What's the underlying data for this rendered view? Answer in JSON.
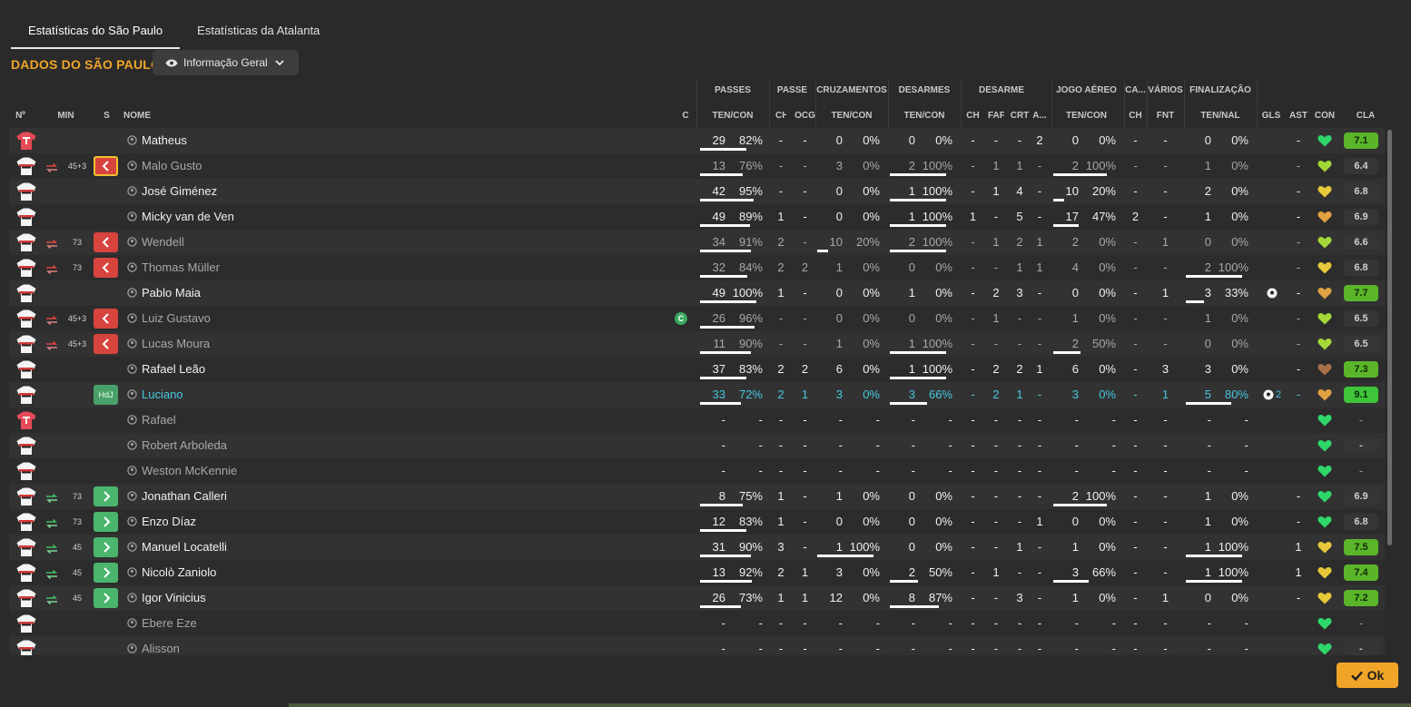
{
  "tabs": [
    {
      "label": "Estatísticas do São Paulo",
      "active": true
    },
    {
      "label": "Estatísticas da Atalanta",
      "active": false
    }
  ],
  "section_title": "DADOS DO SÃO PAULO",
  "view_dropdown": {
    "label": "Informação Geral",
    "icon": "eye-icon"
  },
  "column_groups": [
    "PASSES",
    "PASSE",
    "CRUZAMENTOS",
    "DESARMES",
    "DESARME",
    "JOGO AÉREO",
    "CA...",
    "VÁRIOS",
    "FINALIZAÇÃO"
  ],
  "columns": [
    "Nº",
    "MIN",
    "S",
    "NOME",
    "C",
    "TEN/CON",
    "CH",
    "OCG",
    "TEN/CON",
    "TEN/CON",
    "CH",
    "FAF",
    "CRT",
    "A...",
    "TEN/CON",
    "CH",
    "FNT",
    "TEN/NAL",
    "GLS",
    "AST",
    "CON",
    "CLA"
  ],
  "colors": {
    "accent": "#f0a528",
    "sub_out": "#d7443e",
    "sub_in": "#4bb56e",
    "motm": "#46c8e0",
    "rating_good": "#5ab52a"
  },
  "players": [
    {
      "name": "Matheus",
      "gk": true,
      "sub": "",
      "min": "",
      "pass": [
        "29",
        "82%"
      ],
      "pass_bar": 0.82,
      "ch": "-",
      "ocg": "-",
      "cross": [
        "0",
        "0%"
      ],
      "cross_bar": 0,
      "tackle": [
        "0",
        "0%"
      ],
      "tackle_bar": 0,
      "d_ch": "-",
      "faf": "-",
      "crt": "-",
      "a": "2",
      "air": [
        "0",
        "0%"
      ],
      "air_bar": 0,
      "ca_ch": "-",
      "fnt": "-",
      "shots": [
        "0",
        "0%"
      ],
      "shots_bar": 0,
      "gls": "",
      "ast": "-",
      "con": "green",
      "cla": "7.1",
      "cla_type": "good"
    },
    {
      "name": "Malo Gusto",
      "gk": false,
      "sub": "out",
      "sel": true,
      "min": "45+3",
      "pass": [
        "13",
        "76%"
      ],
      "pass_bar": 0.76,
      "ch": "-",
      "ocg": "-",
      "cross": [
        "3",
        "0%"
      ],
      "cross_bar": 0,
      "tackle": [
        "2",
        "100%"
      ],
      "tackle_bar": 1,
      "d_ch": "-",
      "faf": "1",
      "crt": "1",
      "a": "-",
      "air": [
        "2",
        "100%"
      ],
      "air_bar": 1,
      "ca_ch": "-",
      "fnt": "-",
      "shots": [
        "1",
        "0%"
      ],
      "shots_bar": 0,
      "gls": "",
      "ast": "-",
      "con": "yellowgreen",
      "cla": "6.4",
      "cla_type": "neutral"
    },
    {
      "name": "José Giménez",
      "gk": false,
      "sub": "",
      "min": "",
      "pass": [
        "42",
        "95%"
      ],
      "pass_bar": 0.95,
      "ch": "-",
      "ocg": "-",
      "cross": [
        "0",
        "0%"
      ],
      "cross_bar": 0,
      "tackle": [
        "1",
        "100%"
      ],
      "tackle_bar": 1,
      "d_ch": "-",
      "faf": "1",
      "crt": "4",
      "a": "-",
      "air": [
        "10",
        "20%"
      ],
      "air_bar": 0.2,
      "ca_ch": "-",
      "fnt": "-",
      "shots": [
        "2",
        "0%"
      ],
      "shots_bar": 0,
      "gls": "",
      "ast": "-",
      "con": "yellow",
      "cla": "6.8",
      "cla_type": "neutral"
    },
    {
      "name": "Micky van de Ven",
      "gk": false,
      "sub": "",
      "min": "",
      "pass": [
        "49",
        "89%"
      ],
      "pass_bar": 0.89,
      "ch": "1",
      "ocg": "-",
      "cross": [
        "0",
        "0%"
      ],
      "cross_bar": 0,
      "tackle": [
        "1",
        "100%"
      ],
      "tackle_bar": 1,
      "d_ch": "1",
      "faf": "-",
      "crt": "5",
      "a": "-",
      "air": [
        "17",
        "47%"
      ],
      "air_bar": 0.47,
      "ca_ch": "2",
      "fnt": "-",
      "shots": [
        "1",
        "0%"
      ],
      "shots_bar": 0,
      "gls": "",
      "ast": "-",
      "con": "orange",
      "cla": "6.9",
      "cla_type": "neutral"
    },
    {
      "name": "Wendell",
      "gk": false,
      "sub": "out",
      "min": "73",
      "pass": [
        "34",
        "91%"
      ],
      "pass_bar": 0.91,
      "ch": "2",
      "ocg": "-",
      "cross": [
        "10",
        "20%"
      ],
      "cross_bar": 0.2,
      "tackle": [
        "2",
        "100%"
      ],
      "tackle_bar": 1,
      "d_ch": "-",
      "faf": "1",
      "crt": "2",
      "a": "1",
      "air": [
        "2",
        "0%"
      ],
      "air_bar": 0,
      "ca_ch": "-",
      "fnt": "1",
      "shots": [
        "0",
        "0%"
      ],
      "shots_bar": 0,
      "gls": "",
      "ast": "-",
      "con": "yellowgreen",
      "cla": "6.6",
      "cla_type": "neutral"
    },
    {
      "name": "Thomas Müller",
      "gk": false,
      "sub": "out",
      "min": "73",
      "pass": [
        "32",
        "84%"
      ],
      "pass_bar": 0.84,
      "ch": "2",
      "ocg": "2",
      "cross": [
        "1",
        "0%"
      ],
      "cross_bar": 0,
      "tackle": [
        "0",
        "0%"
      ],
      "tackle_bar": 0,
      "d_ch": "-",
      "faf": "-",
      "crt": "1",
      "a": "1",
      "air": [
        "4",
        "0%"
      ],
      "air_bar": 0,
      "ca_ch": "-",
      "fnt": "-",
      "shots": [
        "2",
        "100%"
      ],
      "shots_bar": 1,
      "gls": "",
      "ast": "-",
      "con": "yellow",
      "cla": "6.8",
      "cla_type": "neutral"
    },
    {
      "name": "Pablo Maia",
      "gk": false,
      "sub": "",
      "min": "",
      "pass": [
        "49",
        "100%"
      ],
      "pass_bar": 1,
      "ch": "1",
      "ocg": "-",
      "cross": [
        "0",
        "0%"
      ],
      "cross_bar": 0,
      "tackle": [
        "1",
        "0%"
      ],
      "tackle_bar": 0,
      "d_ch": "-",
      "faf": "2",
      "crt": "3",
      "a": "-",
      "air": [
        "0",
        "0%"
      ],
      "air_bar": 0,
      "ca_ch": "-",
      "fnt": "1",
      "shots": [
        "3",
        "33%"
      ],
      "shots_bar": 0.33,
      "gls": "ball",
      "gls_count": "",
      "ast": "-",
      "con": "orange",
      "cla": "7.7",
      "cla_type": "good"
    },
    {
      "name": "Luiz Gustavo",
      "gk": false,
      "sub": "out",
      "min": "45+3",
      "captain": "C",
      "pass": [
        "26",
        "96%"
      ],
      "pass_bar": 0.96,
      "ch": "-",
      "ocg": "-",
      "cross": [
        "0",
        "0%"
      ],
      "cross_bar": 0,
      "tackle": [
        "0",
        "0%"
      ],
      "tackle_bar": 0,
      "d_ch": "-",
      "faf": "1",
      "crt": "-",
      "a": "-",
      "air": [
        "1",
        "0%"
      ],
      "air_bar": 0,
      "ca_ch": "-",
      "fnt": "-",
      "shots": [
        "1",
        "0%"
      ],
      "shots_bar": 0,
      "gls": "",
      "ast": "-",
      "con": "yellowgreen",
      "cla": "6.5",
      "cla_type": "neutral"
    },
    {
      "name": "Lucas Moura",
      "gk": false,
      "sub": "out",
      "min": "45+3",
      "pass": [
        "11",
        "90%"
      ],
      "pass_bar": 0.9,
      "ch": "-",
      "ocg": "-",
      "cross": [
        "1",
        "0%"
      ],
      "cross_bar": 0,
      "tackle": [
        "1",
        "100%"
      ],
      "tackle_bar": 1,
      "d_ch": "-",
      "faf": "-",
      "crt": "-",
      "a": "-",
      "air": [
        "2",
        "50%"
      ],
      "air_bar": 0.5,
      "ca_ch": "-",
      "fnt": "-",
      "shots": [
        "0",
        "0%"
      ],
      "shots_bar": 0,
      "gls": "",
      "ast": "-",
      "con": "yellowgreen",
      "cla": "6.5",
      "cla_type": "neutral"
    },
    {
      "name": "Rafael Leão",
      "gk": false,
      "sub": "",
      "min": "",
      "pass": [
        "37",
        "83%"
      ],
      "pass_bar": 0.83,
      "ch": "2",
      "ocg": "2",
      "cross": [
        "6",
        "0%"
      ],
      "cross_bar": 0,
      "tackle": [
        "1",
        "100%"
      ],
      "tackle_bar": 1,
      "d_ch": "-",
      "faf": "2",
      "crt": "2",
      "a": "1",
      "air": [
        "6",
        "0%"
      ],
      "air_bar": 0,
      "ca_ch": "-",
      "fnt": "3",
      "shots": [
        "3",
        "0%"
      ],
      "shots_bar": 0,
      "gls": "",
      "ast": "-",
      "con": "brown",
      "cla": "7.3",
      "cla_type": "good"
    },
    {
      "name": "Luciano",
      "gk": false,
      "sub": "hdj",
      "hdj_label": "HdJ",
      "min": "",
      "motm": true,
      "pass": [
        "33",
        "72%"
      ],
      "pass_bar": 0.72,
      "ch": "2",
      "ocg": "1",
      "cross": [
        "3",
        "0%"
      ],
      "cross_bar": 0,
      "tackle": [
        "3",
        "66%"
      ],
      "tackle_bar": 0.66,
      "d_ch": "-",
      "faf": "2",
      "crt": "1",
      "a": "-",
      "air": [
        "3",
        "0%"
      ],
      "air_bar": 0,
      "ca_ch": "-",
      "fnt": "1",
      "shots": [
        "5",
        "80%"
      ],
      "shots_bar": 0.8,
      "gls": "ball",
      "gls_count": "2",
      "ast": "-",
      "con": "orange",
      "cla": "9.1",
      "cla_type": "vgood"
    },
    {
      "name": "Rafael",
      "gk": true,
      "unused": true,
      "sub": "",
      "min": "",
      "pass": [
        "-",
        "-"
      ],
      "pass_bar": 0,
      "ch": "-",
      "ocg": "-",
      "cross": [
        "-",
        "-"
      ],
      "cross_bar": 0,
      "tackle": [
        "-",
        "-"
      ],
      "tackle_bar": 0,
      "d_ch": "-",
      "faf": "-",
      "crt": "-",
      "a": "-",
      "air": [
        "-",
        "-"
      ],
      "air_bar": 0,
      "ca_ch": "-",
      "fnt": "-",
      "shots": [
        "-",
        "-"
      ],
      "shots_bar": 0,
      "gls": "",
      "ast": "",
      "con": "green",
      "cla": "-",
      "cla_type": "none"
    },
    {
      "name": "Robert Arboleda",
      "gk": false,
      "unused": true,
      "sub": "",
      "min": "",
      "pass": [
        "-",
        "-"
      ],
      "pass_bar": 0,
      "ch": "-",
      "ocg": "-",
      "cross": [
        "-",
        "-"
      ],
      "cross_bar": 0,
      "tackle": [
        "-",
        "-"
      ],
      "tackle_bar": 0,
      "d_ch": "-",
      "faf": "-",
      "crt": "-",
      "a": "-",
      "air": [
        "-",
        "-"
      ],
      "air_bar": 0,
      "ca_ch": "-",
      "fnt": "-",
      "shots": [
        "-",
        "-"
      ],
      "shots_bar": 0,
      "gls": "",
      "ast": "",
      "con": "green",
      "cla": "-",
      "cla_type": "neutral"
    },
    {
      "name": "Weston McKennie",
      "gk": false,
      "unused": true,
      "sub": "",
      "min": "",
      "pass": [
        "-",
        "-"
      ],
      "pass_bar": 0,
      "ch": "-",
      "ocg": "-",
      "cross": [
        "-",
        "-"
      ],
      "cross_bar": 0,
      "tackle": [
        "-",
        "-"
      ],
      "tackle_bar": 0,
      "d_ch": "-",
      "faf": "-",
      "crt": "-",
      "a": "-",
      "air": [
        "-",
        "-"
      ],
      "air_bar": 0,
      "ca_ch": "-",
      "fnt": "-",
      "shots": [
        "-",
        "-"
      ],
      "shots_bar": 0,
      "gls": "",
      "ast": "",
      "con": "green",
      "cla": "-",
      "cla_type": "none"
    },
    {
      "name": "Jonathan Calleri",
      "gk": false,
      "sub": "in",
      "min": "73",
      "pass": [
        "8",
        "75%"
      ],
      "pass_bar": 0.75,
      "ch": "1",
      "ocg": "-",
      "cross": [
        "1",
        "0%"
      ],
      "cross_bar": 0,
      "tackle": [
        "0",
        "0%"
      ],
      "tackle_bar": 0,
      "d_ch": "-",
      "faf": "-",
      "crt": "-",
      "a": "-",
      "air": [
        "2",
        "100%"
      ],
      "air_bar": 1,
      "ca_ch": "-",
      "fnt": "-",
      "shots": [
        "1",
        "0%"
      ],
      "shots_bar": 0,
      "gls": "",
      "ast": "-",
      "con": "green",
      "cla": "6.9",
      "cla_type": "neutral"
    },
    {
      "name": "Enzo Díaz",
      "gk": false,
      "sub": "in",
      "min": "73",
      "pass": [
        "12",
        "83%"
      ],
      "pass_bar": 0.83,
      "ch": "1",
      "ocg": "-",
      "cross": [
        "0",
        "0%"
      ],
      "cross_bar": 0,
      "tackle": [
        "0",
        "0%"
      ],
      "tackle_bar": 0,
      "d_ch": "-",
      "faf": "-",
      "crt": "-",
      "a": "1",
      "air": [
        "0",
        "0%"
      ],
      "air_bar": 0,
      "ca_ch": "-",
      "fnt": "-",
      "shots": [
        "1",
        "0%"
      ],
      "shots_bar": 0,
      "gls": "",
      "ast": "-",
      "con": "green",
      "cla": "6.8",
      "cla_type": "neutral"
    },
    {
      "name": "Manuel Locatelli",
      "gk": false,
      "sub": "in",
      "min": "45",
      "pass": [
        "31",
        "90%"
      ],
      "pass_bar": 0.9,
      "ch": "3",
      "ocg": "-",
      "cross": [
        "1",
        "100%"
      ],
      "cross_bar": 1,
      "tackle": [
        "0",
        "0%"
      ],
      "tackle_bar": 0,
      "d_ch": "-",
      "faf": "-",
      "crt": "1",
      "a": "-",
      "air": [
        "1",
        "0%"
      ],
      "air_bar": 0,
      "ca_ch": "-",
      "fnt": "-",
      "shots": [
        "1",
        "100%"
      ],
      "shots_bar": 1,
      "gls": "",
      "ast": "1",
      "con": "yellow",
      "cla": "7.5",
      "cla_type": "good"
    },
    {
      "name": "Nicolò Zaniolo",
      "gk": false,
      "sub": "in",
      "min": "45",
      "pass": [
        "13",
        "92%"
      ],
      "pass_bar": 0.92,
      "ch": "2",
      "ocg": "1",
      "cross": [
        "3",
        "0%"
      ],
      "cross_bar": 0,
      "tackle": [
        "2",
        "50%"
      ],
      "tackle_bar": 0.5,
      "d_ch": "-",
      "faf": "1",
      "crt": "-",
      "a": "-",
      "air": [
        "3",
        "66%"
      ],
      "air_bar": 0.66,
      "ca_ch": "-",
      "fnt": "-",
      "shots": [
        "1",
        "100%"
      ],
      "shots_bar": 1,
      "gls": "",
      "ast": "1",
      "con": "yellow",
      "cla": "7.4",
      "cla_type": "good"
    },
    {
      "name": "Igor Vinicius",
      "gk": false,
      "sub": "in",
      "min": "45",
      "pass": [
        "26",
        "73%"
      ],
      "pass_bar": 0.73,
      "ch": "1",
      "ocg": "1",
      "cross": [
        "12",
        "0%"
      ],
      "cross_bar": 0,
      "tackle": [
        "8",
        "87%"
      ],
      "tackle_bar": 0.87,
      "d_ch": "-",
      "faf": "-",
      "crt": "3",
      "a": "-",
      "air": [
        "1",
        "0%"
      ],
      "air_bar": 0,
      "ca_ch": "-",
      "fnt": "1",
      "shots": [
        "0",
        "0%"
      ],
      "shots_bar": 0,
      "gls": "",
      "ast": "-",
      "con": "yellow",
      "cla": "7.2",
      "cla_type": "good"
    },
    {
      "name": "Ebere Eze",
      "gk": false,
      "unused": true,
      "sub": "",
      "min": "",
      "pass": [
        "-",
        "-"
      ],
      "pass_bar": 0,
      "ch": "-",
      "ocg": "-",
      "cross": [
        "-",
        "-"
      ],
      "cross_bar": 0,
      "tackle": [
        "-",
        "-"
      ],
      "tackle_bar": 0,
      "d_ch": "-",
      "faf": "-",
      "crt": "-",
      "a": "-",
      "air": [
        "-",
        "-"
      ],
      "air_bar": 0,
      "ca_ch": "-",
      "fnt": "-",
      "shots": [
        "-",
        "-"
      ],
      "shots_bar": 0,
      "gls": "",
      "ast": "",
      "con": "green",
      "cla": "-",
      "cla_type": "none"
    },
    {
      "name": "Alisson",
      "gk": false,
      "unused": true,
      "sub": "",
      "min": "",
      "pass": [
        "-",
        "-"
      ],
      "pass_bar": 0,
      "ch": "-",
      "ocg": "-",
      "cross": [
        "-",
        "-"
      ],
      "cross_bar": 0,
      "tackle": [
        "-",
        "-"
      ],
      "tackle_bar": 0,
      "d_ch": "-",
      "faf": "-",
      "crt": "-",
      "a": "-",
      "air": [
        "-",
        "-"
      ],
      "air_bar": 0,
      "ca_ch": "-",
      "fnt": "-",
      "shots": [
        "-",
        "-"
      ],
      "shots_bar": 0,
      "gls": "",
      "ast": "",
      "con": "green",
      "cla": "-",
      "cla_type": "neutral"
    }
  ],
  "ok_button": {
    "label": "Ok"
  }
}
